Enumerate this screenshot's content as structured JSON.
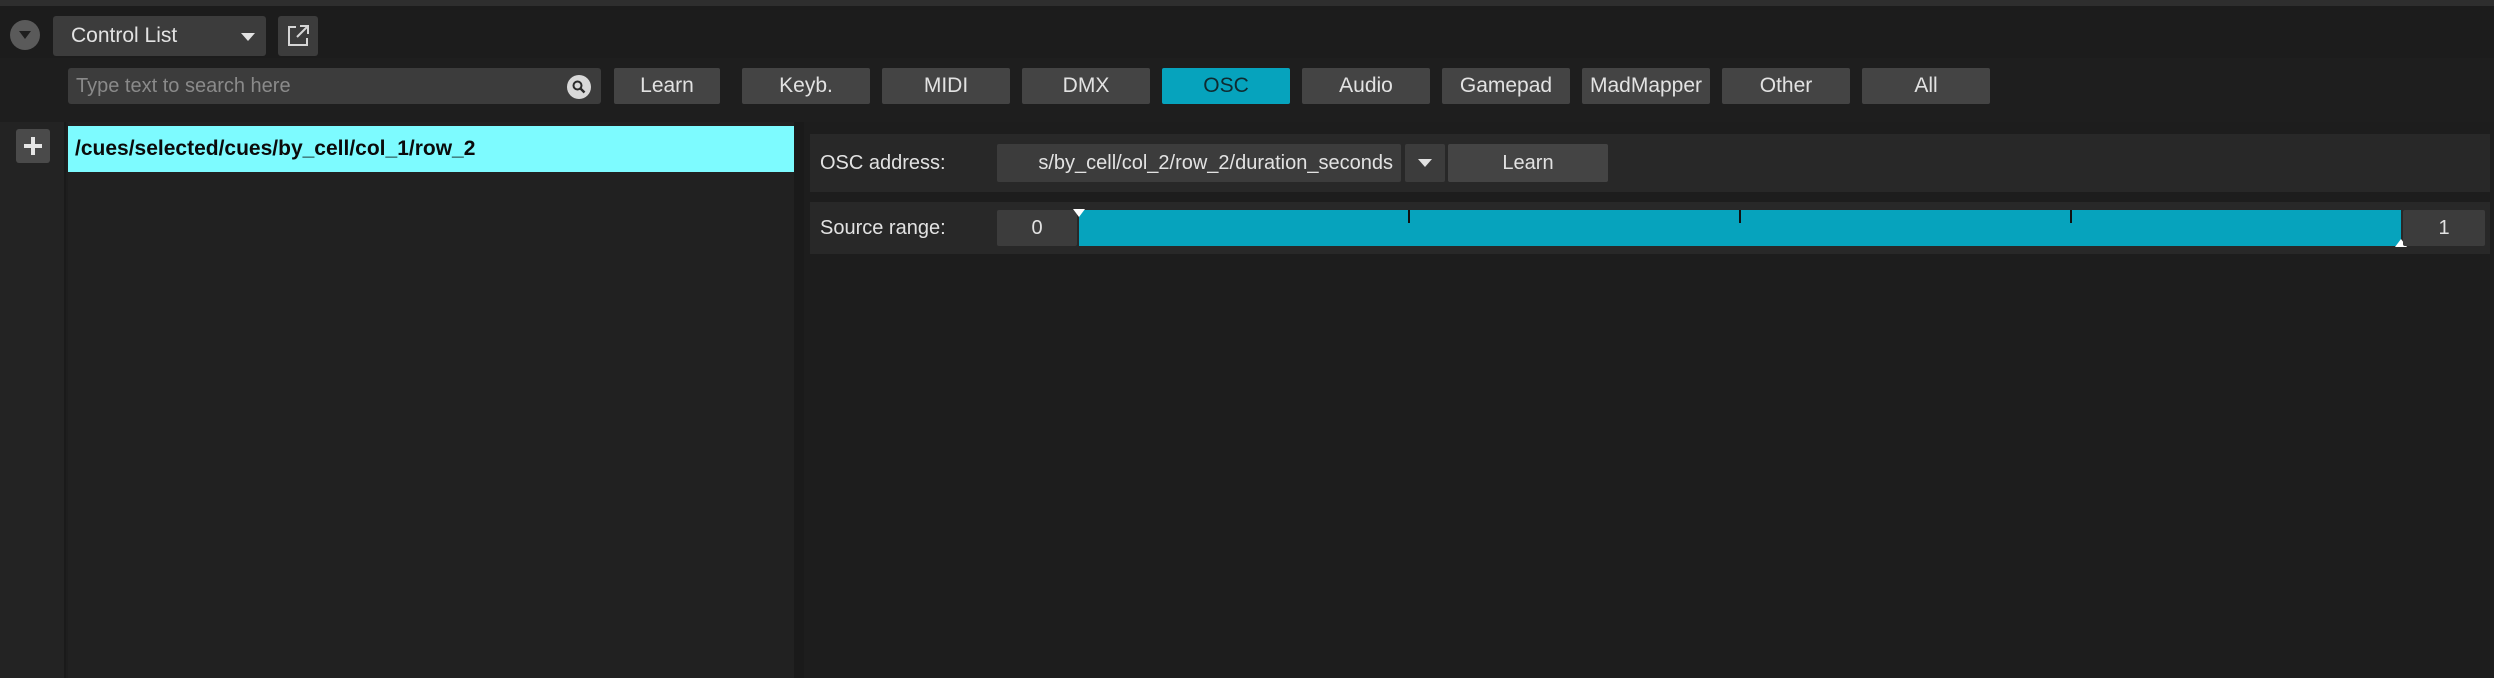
{
  "header": {
    "panel_title": "Control List"
  },
  "search": {
    "placeholder": "Type text to search here",
    "value": ""
  },
  "filters": {
    "learn_label": "Learn",
    "tabs": [
      {
        "label": "Keyb.",
        "active": false
      },
      {
        "label": "MIDI",
        "active": false
      },
      {
        "label": "DMX",
        "active": false
      },
      {
        "label": "OSC",
        "active": true
      },
      {
        "label": "Audio",
        "active": false
      },
      {
        "label": "Gamepad",
        "active": false
      },
      {
        "label": "MadMapper",
        "active": false
      },
      {
        "label": "Other",
        "active": false
      },
      {
        "label": "All",
        "active": false
      }
    ]
  },
  "control_list": {
    "items": [
      {
        "label": "/cues/selected/cues/by_cell/col_1/row_2",
        "selected": true
      }
    ]
  },
  "detail": {
    "osc_address_label": "OSC address:",
    "osc_address_value": "s/by_cell/col_2/row_2/duration_seconds",
    "learn_label": "Learn",
    "source_range_label": "Source range:",
    "range_min": "0",
    "range_max": "1",
    "range_fill_fraction": 1.0
  },
  "colors": {
    "accent": "#06a3bd",
    "selected_row": "#7dfbff",
    "background": "#1e1e1e",
    "button": "#444444"
  },
  "icons": {
    "collapse": "chevron-down-icon",
    "dropdown": "caret-down-icon",
    "detach": "external-link-icon",
    "search": "search-icon",
    "add": "plus-icon"
  }
}
